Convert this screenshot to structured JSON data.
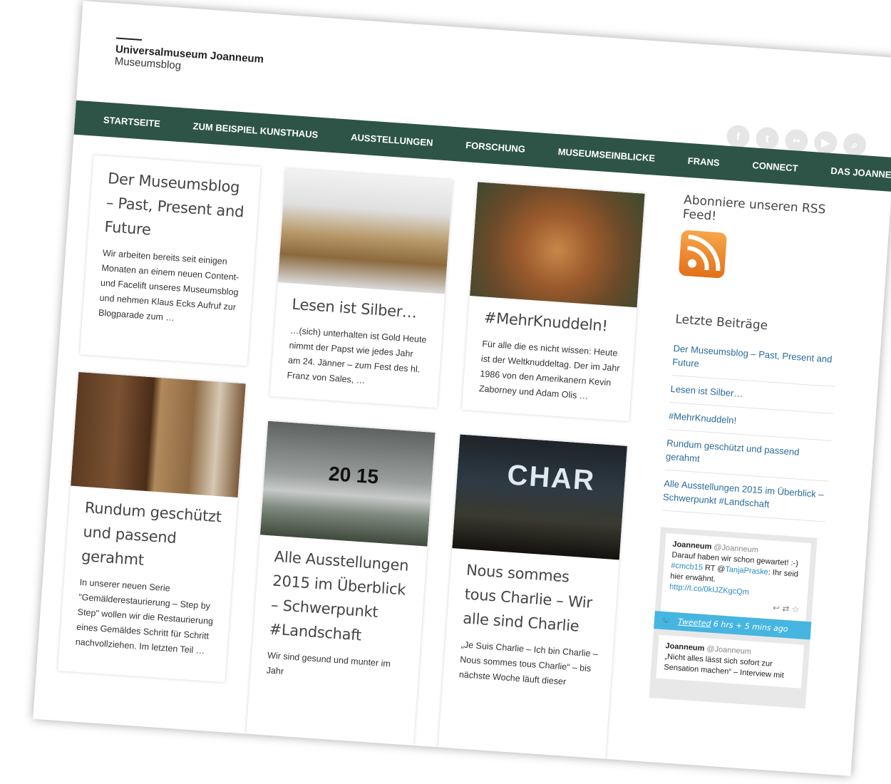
{
  "brand": {
    "name": "Universalmuseum Joanneum",
    "sub": "Museumsblog"
  },
  "social": [
    {
      "icon": "facebook-icon",
      "glyph": "f"
    },
    {
      "icon": "twitter-icon",
      "glyph": "t"
    },
    {
      "icon": "flickr-icon",
      "glyph": "••"
    },
    {
      "icon": "youtube-icon",
      "glyph": "▶"
    },
    {
      "icon": "search-icon",
      "glyph": "⌕"
    }
  ],
  "nav": [
    "STARTSEITE",
    "ZUM BEISPIEL KUNSTHAUS",
    "AUSSTELLUNGEN",
    "FORSCHUNG",
    "MUSEUMSEINBLICKE",
    "FRANS",
    "CONNECT",
    "DAS JOANNEUM"
  ],
  "posts": [
    {
      "title": "Der Museumsblog – Past, Present and Future",
      "text": "Wir arbeiten bereits seit einigen Monaten an einem neuen Content- und Facelift unseres Museumsblog und nehmen Klaus Ecks Aufruf zur Blogparade zum …"
    },
    {
      "title": "Lesen ist Silber…",
      "text": "…(sich) unterhalten ist Gold Heute nimmt der Papst wie jedes Jahr am 24. Jänner – zum Fest des hl. Franz von Sales, …"
    },
    {
      "title": "#MehrKnuddeln!",
      "text": "Für alle die es nicht wissen: Heute ist der Weltknuddeltag. Der im Jahr 1986 von den Amerikanern Kevin Zaborney und Adam Olis …"
    },
    {
      "title": "Rundum geschützt und passend gerahmt",
      "text": "In unserer neuen Serie \"Gemälderestaurierung – Step by Step\" wollen wir die Restaurierung eines Gemäldes Schritt für Schritt nachvollziehen. Im letzten Teil …"
    },
    {
      "title": "Alle Ausstellungen 2015 im Überblick – Schwerpunkt #Landschaft",
      "text": "Wir sind gesund und munter im Jahr",
      "overlay": "20 15"
    },
    {
      "title": "Nous sommes tous Charlie – Wir alle sind Charlie",
      "text": "„Je Suis Charlie – Ich bin Charlie – Nous sommes tous Charlie“ – bis nächste Woche läuft dieser",
      "overlay": "CHAR"
    }
  ],
  "sidebar": {
    "rss_heading": "Abonniere unseren RSS Feed!",
    "recent_heading": "Letzte Beiträge",
    "recent": [
      "Der Museumsblog – Past, Present and Future",
      "Lesen ist Silber…",
      "#MehrKnuddeln!",
      "Rundum geschützt und passend gerahmt",
      "Alle Ausstellungen 2015 im Überblick – Schwerpunkt #Landschaft"
    ]
  },
  "twitter": {
    "tweet1": {
      "user": "Joanneum",
      "handle": "@Joanneum",
      "t1": "Darauf haben wir schon gewartet! :-)",
      "tag": "#cmcb15",
      "rt": " RT @",
      "mention": "TanjaPraske",
      "t2": ": Ihr seid hier erwähnt.",
      "link": "http://t.co/0kIJZKgcQm"
    },
    "bar": {
      "label": "Tweeted",
      "time": "6 hrs + 5 mins ago"
    },
    "tweet2": {
      "user": "Joanneum",
      "handle": "@Joanneum",
      "text": "„Nicht alles lässt sich sofort zur Sensation machen“ – Interview mit"
    }
  }
}
